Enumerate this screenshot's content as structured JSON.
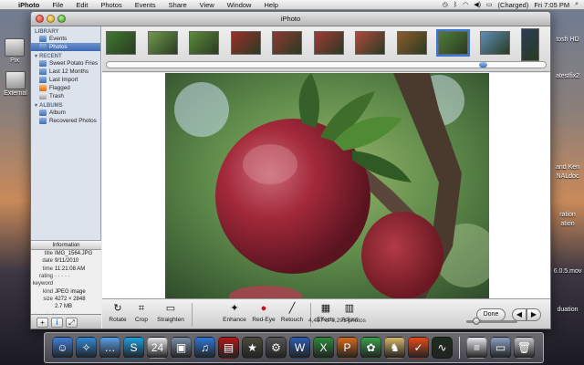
{
  "menubar": {
    "app_name": "iPhoto",
    "items": [
      "File",
      "Edit",
      "Photos",
      "Events",
      "Share",
      "View",
      "Window",
      "Help"
    ],
    "battery": "(Charged)",
    "clock": "Fri 7:05 PM"
  },
  "desktop": {
    "left_labels": [
      "Pix",
      "External"
    ],
    "right_labels": [
      "tosh HD",
      "atestfix2",
      "and Ken",
      "NALdoc",
      "ration",
      "ation",
      "6.0.5.mov",
      "duation"
    ]
  },
  "window": {
    "title": "iPhoto"
  },
  "sidebar": {
    "library_header": "LIBRARY",
    "library_items": [
      {
        "label": "Events",
        "selected": false
      },
      {
        "label": "Photos",
        "selected": true
      }
    ],
    "recent_header": "RECENT",
    "recent_items": [
      {
        "label": "Sweet Potato Fries"
      },
      {
        "label": "Last 12 Months"
      },
      {
        "label": "Last Import"
      },
      {
        "label": "Flagged"
      },
      {
        "label": "Trash"
      }
    ],
    "albums_header": "ALBUMS",
    "album_items": [
      {
        "label": "Album"
      },
      {
        "label": "Recovered Photos"
      }
    ]
  },
  "info": {
    "header": "Information",
    "rows": [
      {
        "label": "title",
        "value": "IMG_1564.JPG"
      },
      {
        "label": "date",
        "value": "9/11/2010"
      },
      {
        "label": "time",
        "value": "11:21:08 AM"
      },
      {
        "label": "rating",
        "value": "· · · · ·"
      },
      {
        "label": "keyword",
        "value": ""
      },
      {
        "label": "kind",
        "value": "JPEG image"
      },
      {
        "label": "size",
        "value": "4272 × 2848"
      },
      {
        "label": "",
        "value": "2.7 MB"
      }
    ],
    "description_placeholder": "description"
  },
  "sidebar_buttons": [
    "+",
    "i",
    "⤢"
  ],
  "filmstrip": {
    "thumbnail_count": 11,
    "active_index": 8,
    "colors": [
      "#3f7a2f",
      "#6f9a4a",
      "#5d8c3c",
      "#9c2e2a",
      "#8d3a32",
      "#a33a35",
      "#b04a3e",
      "#8c5c2c",
      "#4f7d3a",
      "#5e8fb8",
      "#2b3d55"
    ],
    "scroll_position_fraction": 0.86
  },
  "photo": {
    "subject": "red apple on branch"
  },
  "tools": [
    {
      "label": "Rotate",
      "icon": "rotate-icon",
      "glyph": "↻"
    },
    {
      "label": "Crop",
      "icon": "crop-icon",
      "glyph": "⌗"
    },
    {
      "label": "Straighten",
      "icon": "straighten-icon",
      "glyph": "▭"
    },
    {
      "label": "Enhance",
      "icon": "enhance-wand-icon",
      "glyph": "✦"
    },
    {
      "label": "Red-Eye",
      "icon": "red-eye-icon",
      "glyph": "●"
    },
    {
      "label": "Retouch",
      "icon": "retouch-brush-icon",
      "glyph": "╱"
    },
    {
      "label": "Effects",
      "icon": "effects-icon",
      "glyph": "▦"
    },
    {
      "label": "Adjust",
      "icon": "adjust-icon",
      "glyph": "▥"
    }
  ],
  "done_label": "Done",
  "nav": {
    "prev": "◀",
    "next": "▶"
  },
  "status": {
    "photo_count": "4,497 of 9,201 photos",
    "zoom_fraction": 0.15
  },
  "dock": {
    "icons": [
      {
        "name": "finder-icon",
        "color": "#3f7fd6",
        "glyph": "☺"
      },
      {
        "name": "safari-icon",
        "color": "#2f8ad8",
        "glyph": "✧"
      },
      {
        "name": "ichat-icon",
        "color": "#5aa0e8",
        "glyph": "…"
      },
      {
        "name": "skype-icon",
        "color": "#1ea0e0",
        "glyph": "S"
      },
      {
        "name": "ical-icon",
        "color": "#e8e8e8",
        "glyph": "24"
      },
      {
        "name": "iphoto-icon",
        "color": "#7a8fa8",
        "glyph": "▣"
      },
      {
        "name": "itunes-icon",
        "color": "#2f78d8",
        "glyph": "♫"
      },
      {
        "name": "photobooth-icon",
        "color": "#b01818",
        "glyph": "▤"
      },
      {
        "name": "star-app-icon",
        "color": "#4a4a3a",
        "glyph": "★"
      },
      {
        "name": "gear-app-icon",
        "color": "#555",
        "glyph": "⚙"
      },
      {
        "name": "word-icon",
        "color": "#2a5db0",
        "glyph": "W"
      },
      {
        "name": "excel-icon",
        "color": "#2e8a3a",
        "glyph": "X"
      },
      {
        "name": "powerpoint-icon",
        "color": "#d86a1a",
        "glyph": "P"
      },
      {
        "name": "messenger-icon",
        "color": "#3aa04a",
        "glyph": "✿"
      },
      {
        "name": "game-icon",
        "color": "#d8b868",
        "glyph": "♞"
      },
      {
        "name": "nike-icon",
        "color": "#e84a1a",
        "glyph": "✓"
      },
      {
        "name": "activity-monitor-icon",
        "color": "#1e2e1e",
        "glyph": "∿"
      }
    ],
    "right_icons": [
      {
        "name": "document-icon",
        "color": "#e8e8ee",
        "glyph": "≡"
      },
      {
        "name": "folder-stack-icon",
        "color": "#8aa0c0",
        "glyph": "▭"
      },
      {
        "name": "trash-icon",
        "color": "#c8c8cc",
        "glyph": "🗑"
      }
    ]
  }
}
